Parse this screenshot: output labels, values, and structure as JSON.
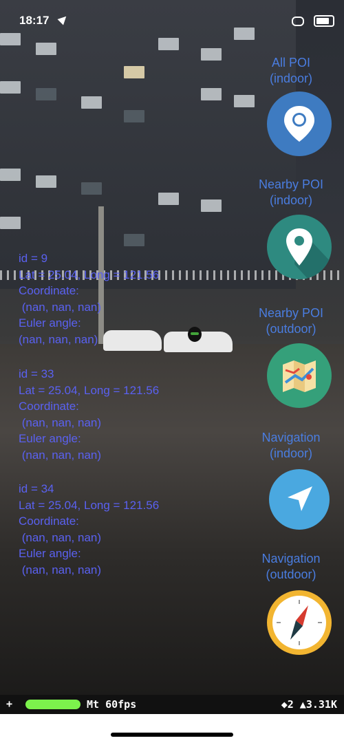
{
  "status_bar": {
    "time": "18:17",
    "icons": [
      "location-arrow-icon",
      "link-icon",
      "battery-icon"
    ]
  },
  "poi_entries": [
    {
      "id_text": "id = 9",
      "latlong_text": "Lat = 25.04, Long = 121.56",
      "coordinate_label": "Coordinate:",
      "coordinate_value": " (nan, nan, nan)",
      "euler_label": "Euler angle:",
      "euler_value": "(nan, nan, nan)"
    },
    {
      "id_text": "id = 33",
      "latlong_text": "Lat = 25.04, Long = 121.56",
      "coordinate_label": "Coordinate:",
      "coordinate_value": " (nan, nan, nan)",
      "euler_label": "Euler angle:",
      "euler_value": " (nan, nan, nan)"
    },
    {
      "id_text": "id = 34",
      "latlong_text": "Lat = 25.04, Long = 121.56",
      "coordinate_label": "Coordinate:",
      "coordinate_value": " (nan, nan, nan)",
      "euler_label": "Euler angle:",
      "euler_value": " (nan, nan, nan)"
    }
  ],
  "nav_buttons": [
    {
      "line1": "All POI",
      "line2": "(indoor)",
      "icon": "location-pin-icon",
      "color": "#3e7bc1"
    },
    {
      "line1": "Nearby POI",
      "line2": "(indoor)",
      "icon": "location-pin-icon",
      "color": "#2e8a80"
    },
    {
      "line1": "Nearby POI",
      "line2": "(outdoor)",
      "icon": "folded-map-icon",
      "color": "#35a07a"
    },
    {
      "line1": "Navigation",
      "line2": "(indoor)",
      "icon": "navigation-arrow-icon",
      "color": "#4aa8e0"
    },
    {
      "line1": "Navigation",
      "line2": "(outdoor)",
      "icon": "compass-icon",
      "color": "#f2b531"
    }
  ],
  "stats_bar": {
    "plus": "+",
    "fps_text": "Mt 60fps",
    "draws_text": "◆2 ▲3.31K",
    "fps_bar_color": "#7cf24c"
  }
}
